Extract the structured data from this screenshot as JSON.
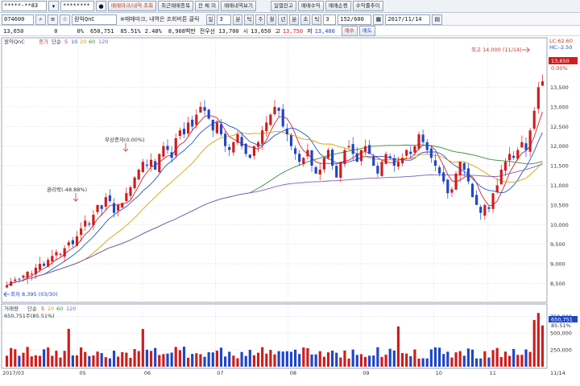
{
  "toolbar": {
    "account": "*****-**83",
    "password": "********",
    "tabs": [
      "매매마크/내역 조회",
      "최근매매종목",
      "잔 체 미",
      "매매내역보기",
      "일별잔고",
      "매매수익",
      "매매손평",
      "수익률추이"
    ]
  },
  "quote": {
    "code": "074600",
    "name": "원익QnC",
    "hint": "※매매마크, 내역은 조회버튼 클릭",
    "period_buttons": [
      "일",
      "3",
      "분",
      "틱",
      "주",
      "월",
      "년",
      "분",
      "초",
      "틱"
    ],
    "step": "3",
    "counter": "152/600",
    "date": "2017/11/14"
  },
  "info": {
    "price": "13,650",
    "change": "0",
    "change_rate": "0%",
    "volume": "650,751",
    "vol_ratio": "85.51%",
    "turnover": "2.48%",
    "amount": "8,908백만",
    "prev_close": "전우선 13,700",
    "open_label": "시",
    "open": "13,650",
    "high_label": "고",
    "high": "13,750",
    "low_label": "저",
    "low": "13,400",
    "buy_button": "매수",
    "sell_button": "매도"
  },
  "price_legend": {
    "name": "원익QnC",
    "items": [
      "종가",
      "단순",
      "5",
      "10",
      "20",
      "60",
      "120"
    ]
  },
  "volume_legend": {
    "items": [
      "거래량",
      "단순",
      "5",
      "20",
      "60",
      "120"
    ],
    "value": "650,751주(85.51%)"
  },
  "annotations": {
    "high": "최고 14,000 (11/14)",
    "low": "최저 8,395 (03/30)",
    "right_issue": "무상증자(0.00%)",
    "ex_right": "권리락(-48.88%)"
  },
  "right_axis": {
    "lc": "LC:62.60",
    "hc": "HC:-2.50",
    "current_price": "13,650",
    "current_pct": "0.00%",
    "vol_current": "650,751",
    "vol_pct": "85.51%"
  },
  "chart_data": {
    "type": "candlestick",
    "price_axis": {
      "min": 8.1,
      "max": 14.35,
      "ticks": [
        "8,500",
        "9,000",
        "9,500",
        "10,000",
        "10,500",
        "11,000",
        "11,500",
        "12,000",
        "12,500",
        "13,000",
        "13,500"
      ]
    },
    "volume_axis": {
      "max": 850,
      "ticks": [
        "750,000",
        "500,000",
        "250,000"
      ]
    },
    "date_labels": [
      "2017/03",
      "05",
      "06",
      "07",
      "08",
      "09",
      "10",
      "11",
      "11/14"
    ],
    "closes_k": [
      8.45,
      8.55,
      8.6,
      8.62,
      8.7,
      8.8,
      8.75,
      8.9,
      9.0,
      8.95,
      9.1,
      9.2,
      9.3,
      9.25,
      9.4,
      9.55,
      9.5,
      9.7,
      9.9,
      10.1,
      10.0,
      10.25,
      10.5,
      10.4,
      10.7,
      10.6,
      10.3,
      10.5,
      10.55,
      10.8,
      10.95,
      11.2,
      11.4,
      11.6,
      11.5,
      11.65,
      11.4,
      11.8,
      12.0,
      11.9,
      11.7,
      12.2,
      12.4,
      12.3,
      12.6,
      12.5,
      12.8,
      13.0,
      12.9,
      12.7,
      12.4,
      12.6,
      12.3,
      12.0,
      11.9,
      12.1,
      12.3,
      12.0,
      11.8,
      11.7,
      12.0,
      12.1,
      12.4,
      12.6,
      12.8,
      13.0,
      12.9,
      12.5,
      12.3,
      12.0,
      11.8,
      11.6,
      11.7,
      11.9,
      11.5,
      11.3,
      11.4,
      11.7,
      11.9,
      11.5,
      11.2,
      11.6,
      11.9,
      12.0,
      11.8,
      11.6,
      11.9,
      12.0,
      11.8,
      11.5,
      11.3,
      11.6,
      11.8,
      11.7,
      11.5,
      11.6,
      11.7,
      11.9,
      11.8,
      12.0,
      12.3,
      12.1,
      11.9,
      11.7,
      11.5,
      11.3,
      11.1,
      10.8,
      10.9,
      11.3,
      11.6,
      11.4,
      11.1,
      10.7,
      10.5,
      10.3,
      10.5,
      10.4,
      10.8,
      11.0,
      11.4,
      11.6,
      11.8,
      11.7,
      11.9,
      12.1,
      11.9,
      12.4,
      12.9,
      13.5,
      13.65
    ]
  }
}
